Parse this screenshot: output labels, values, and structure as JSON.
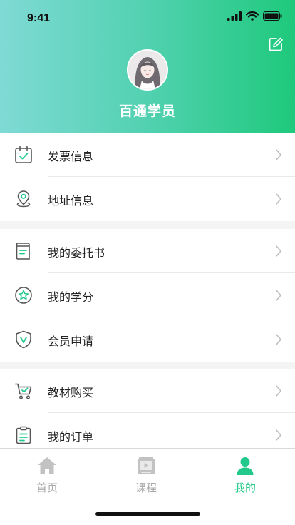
{
  "status_bar": {
    "time": "9:41"
  },
  "profile": {
    "name": "百通学员"
  },
  "colors": {
    "accent": "#22c98a",
    "header_start": "#7fdad5",
    "header_end": "#1ec97c"
  },
  "menu_groups": [
    {
      "items": [
        {
          "label": "发票信息",
          "icon": "calendar-check-icon"
        },
        {
          "label": "地址信息",
          "icon": "location-pin-icon"
        }
      ]
    },
    {
      "items": [
        {
          "label": "我的委托书",
          "icon": "document-icon"
        },
        {
          "label": "我的学分",
          "icon": "star-badge-icon"
        },
        {
          "label": "会员申请",
          "icon": "shield-v-icon"
        }
      ]
    },
    {
      "items": [
        {
          "label": "教材购买",
          "icon": "cart-icon"
        },
        {
          "label": "我的订单",
          "icon": "clipboard-icon"
        }
      ]
    }
  ],
  "tabbar": {
    "tabs": [
      {
        "label": "首页",
        "icon": "home-icon"
      },
      {
        "label": "课程",
        "icon": "course-book-icon"
      },
      {
        "label": "我的",
        "icon": "user-icon",
        "active": true
      }
    ]
  }
}
